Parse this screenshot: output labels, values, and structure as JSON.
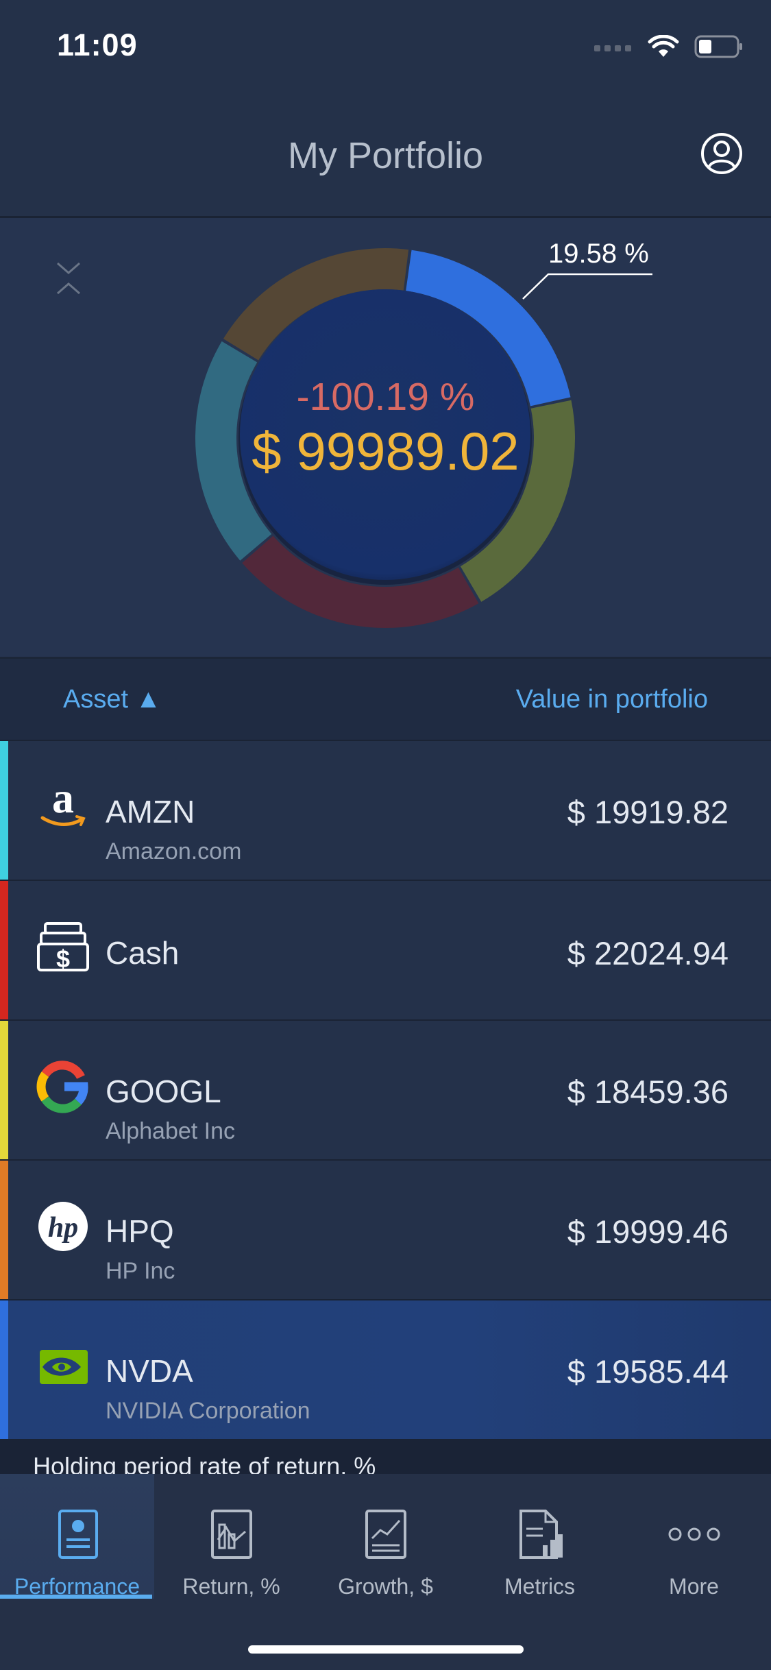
{
  "status_bar": {
    "time": "11:09"
  },
  "header": {
    "title": "My Portfolio"
  },
  "chart": {
    "center_percent": "-100.19 %",
    "center_total": "$ 99989.02",
    "callout_label": "19.58 %",
    "segments": [
      {
        "name": "NVDA",
        "color": "#2f6fde",
        "share": 19.58
      },
      {
        "name": "HPQ",
        "color": "#5a6a3c",
        "share": 20.0
      },
      {
        "name": "Cash",
        "color": "#52283a",
        "share": 22.03
      },
      {
        "name": "AMZN",
        "color": "#316a81",
        "share": 19.92
      },
      {
        "name": "GOOGL",
        "color": "#554735",
        "share": 18.46
      }
    ]
  },
  "columns": {
    "asset": "Asset ▲",
    "value": "Value in portfolio"
  },
  "assets": [
    {
      "ticker": "AMZN",
      "company": "Amazon.com",
      "value": "$ 19919.82",
      "stripe": "#3fd0e0",
      "logo": "amazon-logo-icon"
    },
    {
      "ticker": "Cash",
      "company": "",
      "value": "$ 22024.94",
      "stripe": "#d4271f",
      "logo": "cash-register-icon"
    },
    {
      "ticker": "GOOGL",
      "company": "Alphabet Inc",
      "value": "$ 18459.36",
      "stripe": "#e3d83a",
      "logo": "google-logo-icon"
    },
    {
      "ticker": "HPQ",
      "company": "HP Inc",
      "value": "$ 19999.46",
      "stripe": "#e07b26",
      "logo": "hp-logo-icon"
    },
    {
      "ticker": "NVDA",
      "company": "NVIDIA Corporation",
      "value": "$ 19585.44",
      "stripe": "#2f6fde",
      "logo": "nvidia-logo-icon"
    }
  ],
  "teaser": {
    "text": "Holding period rate of return, %"
  },
  "tabs": [
    {
      "label": "Performance",
      "icon": "performance-report-icon",
      "active": true
    },
    {
      "label": "Return, %",
      "icon": "return-chart-icon",
      "active": false
    },
    {
      "label": "Growth, $",
      "icon": "growth-chart-icon",
      "active": false
    },
    {
      "label": "Metrics",
      "icon": "metrics-document-icon",
      "active": false
    },
    {
      "label": "More",
      "icon": "more-dots-icon",
      "active": false
    }
  ]
}
